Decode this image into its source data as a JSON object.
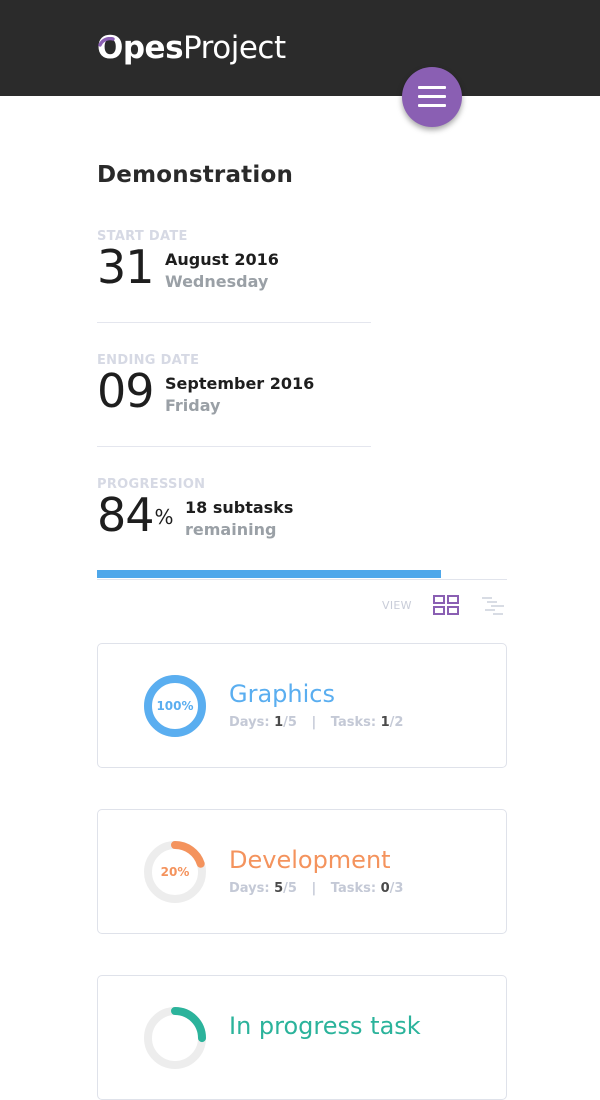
{
  "app": {
    "logo_o": "O",
    "logo_bold": "pes",
    "logo_light": "Project"
  },
  "project": {
    "title": "Demonstration"
  },
  "start": {
    "label": "START DATE",
    "day": "31",
    "month_year": "August 2016",
    "weekday": "Wednesday"
  },
  "end": {
    "label": "ENDING DATE",
    "day": "09",
    "month_year": "September 2016",
    "weekday": "Friday"
  },
  "progression": {
    "label": "PROGRESSION",
    "value": "84",
    "unit": "%",
    "subtasks": "18 subtasks",
    "remaining": "remaining",
    "fraction": 0.84
  },
  "view": {
    "label": "VIEW",
    "active": "grid"
  },
  "colors": {
    "header": "#2b2b2b",
    "accent": "#8a5fb3",
    "progress": "#4ea7ea",
    "graphics": "#5aaef0",
    "development": "#f4935d",
    "in_progress": "#2bb39b"
  },
  "cards": [
    {
      "name": "Graphics",
      "percent_label": "100%",
      "percent": 100,
      "color": "#5aaef0",
      "days_label": "Days:",
      "days_done": "1",
      "days_total": "/5",
      "sep": "|",
      "tasks_label": "Tasks:",
      "tasks_done": "1",
      "tasks_total": "/2"
    },
    {
      "name": "Development",
      "percent_label": "20%",
      "percent": 20,
      "color": "#f4935d",
      "days_label": "Days:",
      "days_done": "5",
      "days_total": "/5",
      "sep": "|",
      "tasks_label": "Tasks:",
      "tasks_done": "0",
      "tasks_total": "/3"
    },
    {
      "name": "In progress task",
      "percent": 25,
      "color": "#2bb39b"
    }
  ]
}
